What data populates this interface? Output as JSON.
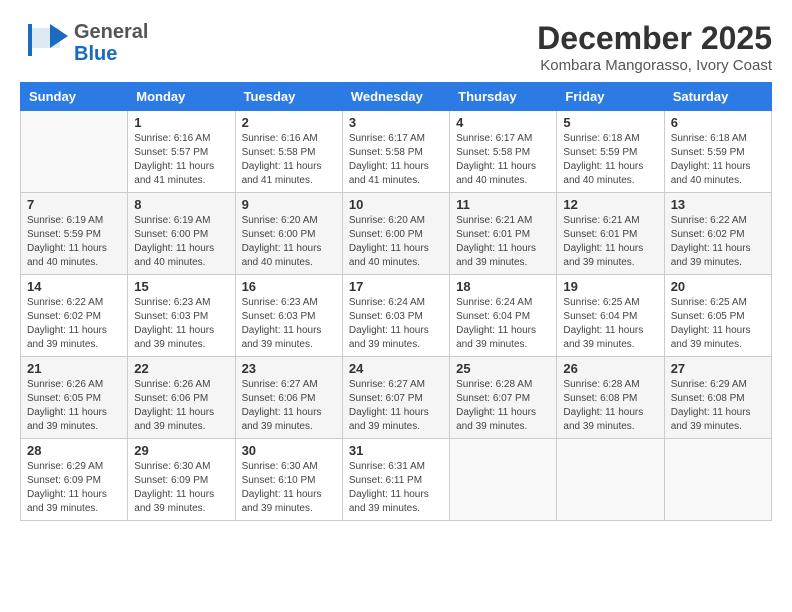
{
  "header": {
    "logo_general": "General",
    "logo_blue": "Blue",
    "main_title": "December 2025",
    "subtitle": "Kombara Mangorasso, Ivory Coast"
  },
  "days_of_week": [
    "Sunday",
    "Monday",
    "Tuesday",
    "Wednesday",
    "Thursday",
    "Friday",
    "Saturday"
  ],
  "weeks": [
    [
      {
        "day": "",
        "sunrise": "",
        "sunset": "",
        "daylight": "",
        "empty": true
      },
      {
        "day": "1",
        "sunrise": "Sunrise: 6:16 AM",
        "sunset": "Sunset: 5:57 PM",
        "daylight": "Daylight: 11 hours and 41 minutes.",
        "empty": false
      },
      {
        "day": "2",
        "sunrise": "Sunrise: 6:16 AM",
        "sunset": "Sunset: 5:58 PM",
        "daylight": "Daylight: 11 hours and 41 minutes.",
        "empty": false
      },
      {
        "day": "3",
        "sunrise": "Sunrise: 6:17 AM",
        "sunset": "Sunset: 5:58 PM",
        "daylight": "Daylight: 11 hours and 41 minutes.",
        "empty": false
      },
      {
        "day": "4",
        "sunrise": "Sunrise: 6:17 AM",
        "sunset": "Sunset: 5:58 PM",
        "daylight": "Daylight: 11 hours and 40 minutes.",
        "empty": false
      },
      {
        "day": "5",
        "sunrise": "Sunrise: 6:18 AM",
        "sunset": "Sunset: 5:59 PM",
        "daylight": "Daylight: 11 hours and 40 minutes.",
        "empty": false
      },
      {
        "day": "6",
        "sunrise": "Sunrise: 6:18 AM",
        "sunset": "Sunset: 5:59 PM",
        "daylight": "Daylight: 11 hours and 40 minutes.",
        "empty": false
      }
    ],
    [
      {
        "day": "7",
        "sunrise": "Sunrise: 6:19 AM",
        "sunset": "Sunset: 5:59 PM",
        "daylight": "Daylight: 11 hours and 40 minutes.",
        "empty": false
      },
      {
        "day": "8",
        "sunrise": "Sunrise: 6:19 AM",
        "sunset": "Sunset: 6:00 PM",
        "daylight": "Daylight: 11 hours and 40 minutes.",
        "empty": false
      },
      {
        "day": "9",
        "sunrise": "Sunrise: 6:20 AM",
        "sunset": "Sunset: 6:00 PM",
        "daylight": "Daylight: 11 hours and 40 minutes.",
        "empty": false
      },
      {
        "day": "10",
        "sunrise": "Sunrise: 6:20 AM",
        "sunset": "Sunset: 6:00 PM",
        "daylight": "Daylight: 11 hours and 40 minutes.",
        "empty": false
      },
      {
        "day": "11",
        "sunrise": "Sunrise: 6:21 AM",
        "sunset": "Sunset: 6:01 PM",
        "daylight": "Daylight: 11 hours and 39 minutes.",
        "empty": false
      },
      {
        "day": "12",
        "sunrise": "Sunrise: 6:21 AM",
        "sunset": "Sunset: 6:01 PM",
        "daylight": "Daylight: 11 hours and 39 minutes.",
        "empty": false
      },
      {
        "day": "13",
        "sunrise": "Sunrise: 6:22 AM",
        "sunset": "Sunset: 6:02 PM",
        "daylight": "Daylight: 11 hours and 39 minutes.",
        "empty": false
      }
    ],
    [
      {
        "day": "14",
        "sunrise": "Sunrise: 6:22 AM",
        "sunset": "Sunset: 6:02 PM",
        "daylight": "Daylight: 11 hours and 39 minutes.",
        "empty": false
      },
      {
        "day": "15",
        "sunrise": "Sunrise: 6:23 AM",
        "sunset": "Sunset: 6:03 PM",
        "daylight": "Daylight: 11 hours and 39 minutes.",
        "empty": false
      },
      {
        "day": "16",
        "sunrise": "Sunrise: 6:23 AM",
        "sunset": "Sunset: 6:03 PM",
        "daylight": "Daylight: 11 hours and 39 minutes.",
        "empty": false
      },
      {
        "day": "17",
        "sunrise": "Sunrise: 6:24 AM",
        "sunset": "Sunset: 6:03 PM",
        "daylight": "Daylight: 11 hours and 39 minutes.",
        "empty": false
      },
      {
        "day": "18",
        "sunrise": "Sunrise: 6:24 AM",
        "sunset": "Sunset: 6:04 PM",
        "daylight": "Daylight: 11 hours and 39 minutes.",
        "empty": false
      },
      {
        "day": "19",
        "sunrise": "Sunrise: 6:25 AM",
        "sunset": "Sunset: 6:04 PM",
        "daylight": "Daylight: 11 hours and 39 minutes.",
        "empty": false
      },
      {
        "day": "20",
        "sunrise": "Sunrise: 6:25 AM",
        "sunset": "Sunset: 6:05 PM",
        "daylight": "Daylight: 11 hours and 39 minutes.",
        "empty": false
      }
    ],
    [
      {
        "day": "21",
        "sunrise": "Sunrise: 6:26 AM",
        "sunset": "Sunset: 6:05 PM",
        "daylight": "Daylight: 11 hours and 39 minutes.",
        "empty": false
      },
      {
        "day": "22",
        "sunrise": "Sunrise: 6:26 AM",
        "sunset": "Sunset: 6:06 PM",
        "daylight": "Daylight: 11 hours and 39 minutes.",
        "empty": false
      },
      {
        "day": "23",
        "sunrise": "Sunrise: 6:27 AM",
        "sunset": "Sunset: 6:06 PM",
        "daylight": "Daylight: 11 hours and 39 minutes.",
        "empty": false
      },
      {
        "day": "24",
        "sunrise": "Sunrise: 6:27 AM",
        "sunset": "Sunset: 6:07 PM",
        "daylight": "Daylight: 11 hours and 39 minutes.",
        "empty": false
      },
      {
        "day": "25",
        "sunrise": "Sunrise: 6:28 AM",
        "sunset": "Sunset: 6:07 PM",
        "daylight": "Daylight: 11 hours and 39 minutes.",
        "empty": false
      },
      {
        "day": "26",
        "sunrise": "Sunrise: 6:28 AM",
        "sunset": "Sunset: 6:08 PM",
        "daylight": "Daylight: 11 hours and 39 minutes.",
        "empty": false
      },
      {
        "day": "27",
        "sunrise": "Sunrise: 6:29 AM",
        "sunset": "Sunset: 6:08 PM",
        "daylight": "Daylight: 11 hours and 39 minutes.",
        "empty": false
      }
    ],
    [
      {
        "day": "28",
        "sunrise": "Sunrise: 6:29 AM",
        "sunset": "Sunset: 6:09 PM",
        "daylight": "Daylight: 11 hours and 39 minutes.",
        "empty": false
      },
      {
        "day": "29",
        "sunrise": "Sunrise: 6:30 AM",
        "sunset": "Sunset: 6:09 PM",
        "daylight": "Daylight: 11 hours and 39 minutes.",
        "empty": false
      },
      {
        "day": "30",
        "sunrise": "Sunrise: 6:30 AM",
        "sunset": "Sunset: 6:10 PM",
        "daylight": "Daylight: 11 hours and 39 minutes.",
        "empty": false
      },
      {
        "day": "31",
        "sunrise": "Sunrise: 6:31 AM",
        "sunset": "Sunset: 6:11 PM",
        "daylight": "Daylight: 11 hours and 39 minutes.",
        "empty": false
      },
      {
        "day": "",
        "sunrise": "",
        "sunset": "",
        "daylight": "",
        "empty": true
      },
      {
        "day": "",
        "sunrise": "",
        "sunset": "",
        "daylight": "",
        "empty": true
      },
      {
        "day": "",
        "sunrise": "",
        "sunset": "",
        "daylight": "",
        "empty": true
      }
    ]
  ]
}
